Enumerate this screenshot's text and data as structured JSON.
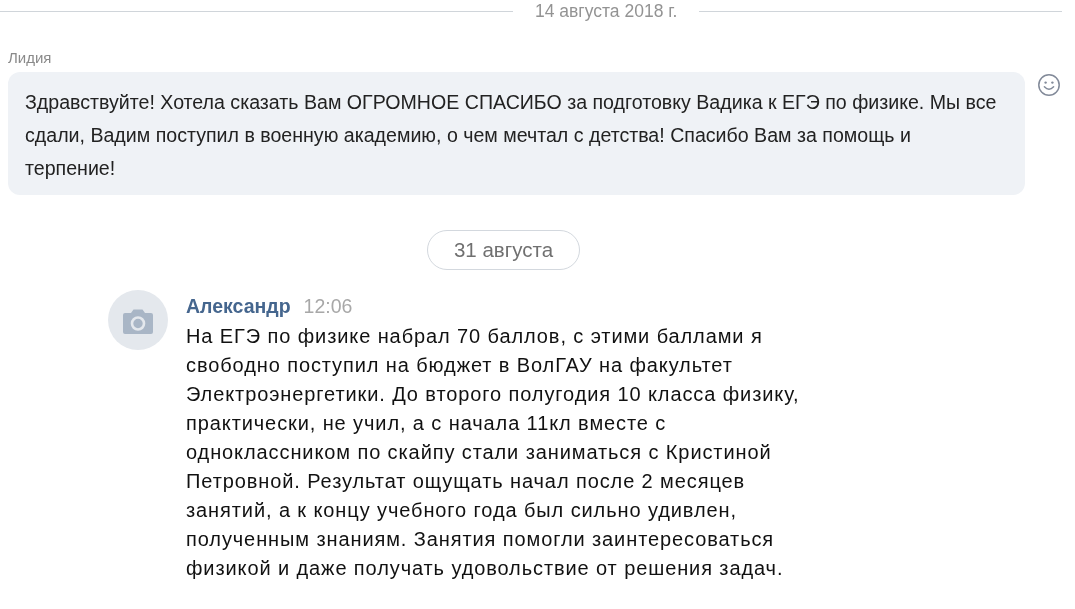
{
  "feed": [
    {
      "kind": "date_line",
      "label": "14 августа 2018 г."
    },
    {
      "kind": "bubble",
      "sender": "Лидия",
      "text": "Здравствуйте! Хотела сказать Вам ОГРОМНОЕ СПАСИБО за подготовку Вадика к ЕГЭ по физике. Мы все сдали, Вадим поступил в военную академию, о чем мечтал с детства! Спасибо Вам за помощь и терпение!"
    },
    {
      "kind": "date_pill",
      "label": "31 августа"
    },
    {
      "kind": "post",
      "author": "Александр",
      "time": "12:06",
      "text": "На ЕГЭ по физике набрал 70 баллов, с этими баллами я свободно поступил на бюджет в ВолГАУ на факультет Электроэнергетики. До второго полугодия 10 класса физику, практически, не учил, а с начала 11кл вместе с одноклассником по скайпу стали заниматься с Кристиной Петровной. Результат ощущать начал после 2 месяцев занятий, а к концу учебного года был сильно удивлен, полученным знаниям. Занятия помогли заинтересоваться физикой и даже получать удовольствие от решения задач."
    }
  ]
}
